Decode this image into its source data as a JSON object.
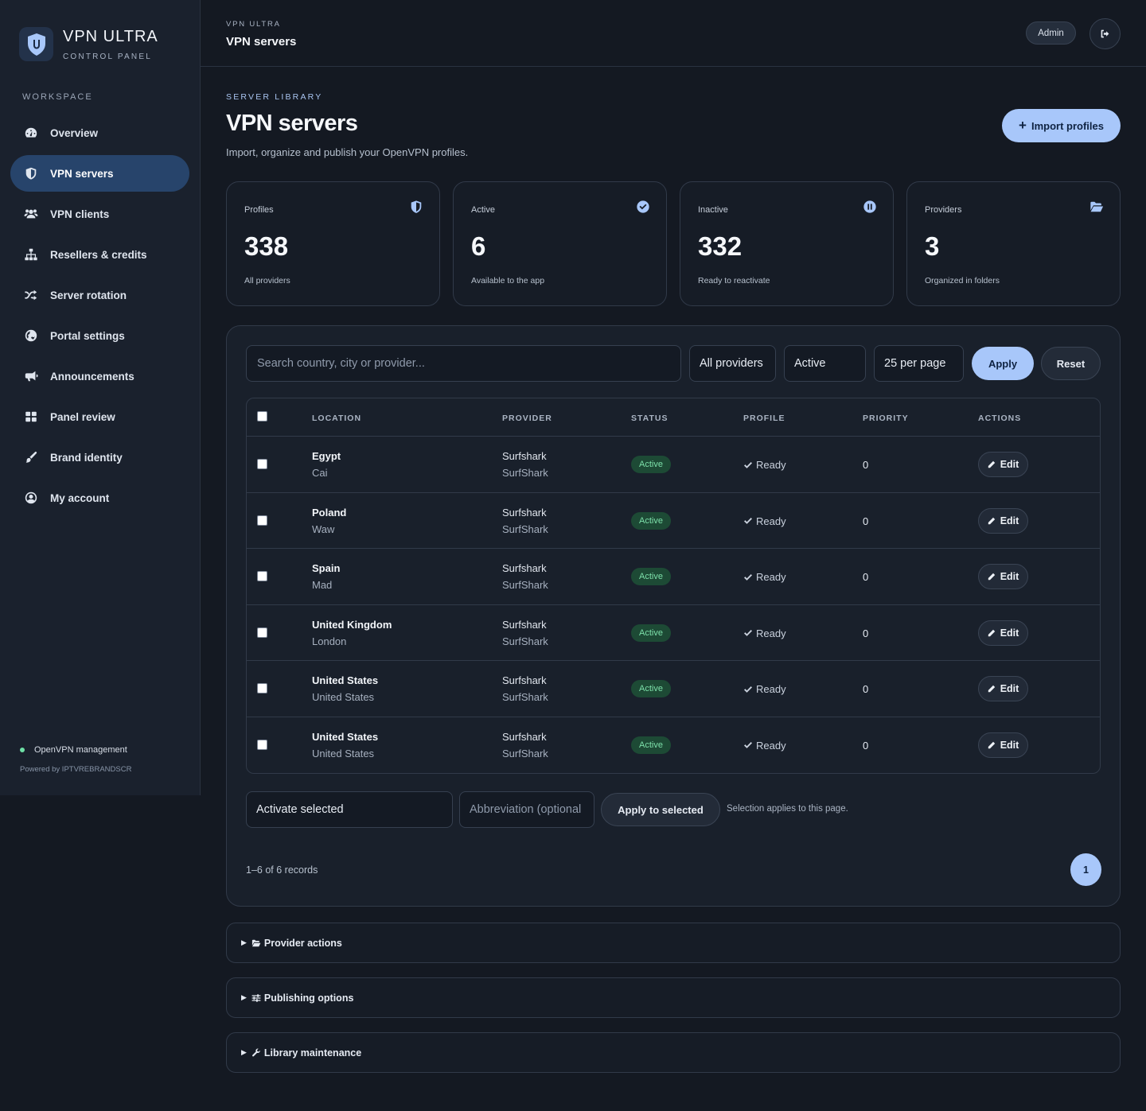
{
  "brand": {
    "title": "VPN ULTRA",
    "subtitle": "CONTROL PANEL",
    "logo_icon": "shield-u-icon"
  },
  "sidebar": {
    "section_label": "WORKSPACE",
    "items": [
      {
        "label": "Overview",
        "icon": "gauge-icon",
        "active": false
      },
      {
        "label": "VPN servers",
        "icon": "shield-icon",
        "active": true
      },
      {
        "label": "VPN clients",
        "icon": "users-icon",
        "active": false
      },
      {
        "label": "Resellers & credits",
        "icon": "sitemap-icon",
        "active": false
      },
      {
        "label": "Server rotation",
        "icon": "shuffle-icon",
        "active": false
      },
      {
        "label": "Portal settings",
        "icon": "globe-icon",
        "active": false
      },
      {
        "label": "Announcements",
        "icon": "megaphone-icon",
        "active": false
      },
      {
        "label": "Panel review",
        "icon": "grid-icon",
        "active": false
      },
      {
        "label": "Brand identity",
        "icon": "brush-icon",
        "active": false
      },
      {
        "label": "My account",
        "icon": "user-circle-icon",
        "active": false
      }
    ],
    "footer_status": "OpenVPN management",
    "footer_powered": "Powered by IPTVREBRANDSCR",
    "status_color": "#6ee0a6"
  },
  "topbar": {
    "crumb": "VPN ULTRA",
    "title": "VPN servers",
    "admin_label": "Admin"
  },
  "header": {
    "eyebrow": "SERVER LIBRARY",
    "title": "VPN servers",
    "subtitle": "Import, organize and publish your OpenVPN profiles.",
    "import_label": "Import profiles"
  },
  "stats": [
    {
      "label": "Profiles",
      "value": "338",
      "note": "All providers",
      "icon": "shield-icon"
    },
    {
      "label": "Active",
      "value": "6",
      "note": "Available to the app",
      "icon": "check-circle-icon"
    },
    {
      "label": "Inactive",
      "value": "332",
      "note": "Ready to reactivate",
      "icon": "pause-circle-icon"
    },
    {
      "label": "Providers",
      "value": "3",
      "note": "Organized in folders",
      "icon": "folder-open-icon"
    }
  ],
  "filters": {
    "search_placeholder": "Search country, city or provider...",
    "provider": "All providers",
    "status": "Active",
    "per_page": "25 per page",
    "apply_label": "Apply",
    "reset_label": "Reset"
  },
  "table": {
    "headers": [
      "LOCATION",
      "PROVIDER",
      "STATUS",
      "PROFILE",
      "PRIORITY",
      "ACTIONS"
    ],
    "rows": [
      {
        "country": "Egypt",
        "city": "Cai",
        "provider": "Surfshark",
        "provider_folder": "SurfShark",
        "status": "Active",
        "profile": "Ready",
        "priority": "0",
        "action": "Edit"
      },
      {
        "country": "Poland",
        "city": "Waw",
        "provider": "Surfshark",
        "provider_folder": "SurfShark",
        "status": "Active",
        "profile": "Ready",
        "priority": "0",
        "action": "Edit"
      },
      {
        "country": "Spain",
        "city": "Mad",
        "provider": "Surfshark",
        "provider_folder": "SurfShark",
        "status": "Active",
        "profile": "Ready",
        "priority": "0",
        "action": "Edit"
      },
      {
        "country": "United Kingdom",
        "city": "London",
        "provider": "Surfshark",
        "provider_folder": "SurfShark",
        "status": "Active",
        "profile": "Ready",
        "priority": "0",
        "action": "Edit"
      },
      {
        "country": "United States",
        "city": "United States",
        "provider": "Surfshark",
        "provider_folder": "SurfShark",
        "status": "Active",
        "profile": "Ready",
        "priority": "0",
        "action": "Edit"
      },
      {
        "country": "United States",
        "city": "United States",
        "provider": "Surfshark",
        "provider_folder": "SurfShark",
        "status": "Active",
        "profile": "Ready",
        "priority": "0",
        "action": "Edit"
      }
    ]
  },
  "bulk": {
    "action": "Activate selected",
    "abbr_placeholder": "Abbreviation (optional",
    "apply_label": "Apply to selected",
    "note": "Selection applies to this page."
  },
  "pagination": {
    "records": "1–6 of 6 records",
    "current_page": "1"
  },
  "sections": [
    {
      "label": "Provider actions",
      "icon": "folder-open-icon"
    },
    {
      "label": "Publishing options",
      "icon": "sliders-icon"
    },
    {
      "label": "Library maintenance",
      "icon": "wrench-icon"
    }
  ],
  "colors": {
    "accent": "#a8c7fa",
    "active_nav": "#27446b",
    "status_active_bg": "#1d4a35",
    "status_active_fg": "#7de0aa"
  }
}
